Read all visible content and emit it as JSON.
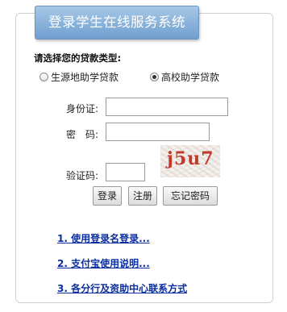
{
  "header": {
    "title": "登录学生在线服务系统"
  },
  "loan_type": {
    "prompt": "请选择您的贷款类型:",
    "options": [
      {
        "label": "生源地助学贷款",
        "selected": false
      },
      {
        "label": "高校助学贷款",
        "selected": true
      }
    ]
  },
  "form": {
    "id_label": "身份证:",
    "id_value": "",
    "password_label": "密　码:",
    "password_value": "",
    "captcha_label": "验证码:",
    "captcha_value": "",
    "captcha_image_text": "j5u7"
  },
  "buttons": {
    "login": "登录",
    "register": "注册",
    "forgot": "忘记密码"
  },
  "links": [
    {
      "label": "1. 使用登录名登录..."
    },
    {
      "label": "2. 支付宝使用说明..."
    },
    {
      "label": "3. 各分行及资助中心联系方式"
    }
  ],
  "colors": {
    "header_gradient_top": "#a7c8e6",
    "header_gradient_bottom": "#6f9fcf",
    "link": "#0b2fa0",
    "captcha_text": "#c0392b"
  }
}
